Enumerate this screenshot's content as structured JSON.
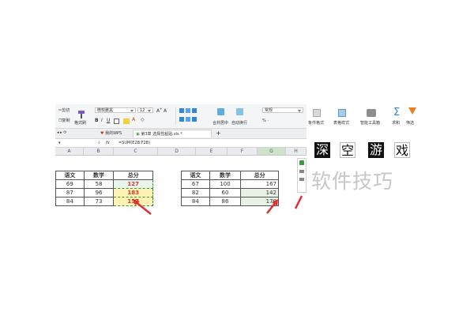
{
  "toolbar": {
    "cut": "剪切",
    "copy": "复制",
    "format_painter": "格式刷",
    "font_name": "微软雅黑",
    "font_size": "12",
    "merge_center": "合并居中",
    "wrap_text": "自动换行",
    "number_format": "常规",
    "conditional_format": "条件格式",
    "table_style": "表格样式",
    "smart_toolbox": "智能工具箱",
    "sum": "求和",
    "filter": "筛选"
  },
  "tabs": {
    "home": "我的WPS",
    "doc": "第3章 选择性粘贴.xls *",
    "add": "+"
  },
  "formula_bar": {
    "fx": "fx",
    "formula": "=SUM(E2B:F2B)"
  },
  "columns": [
    "A",
    "B",
    "C",
    "D",
    "E",
    "F",
    "G",
    "H"
  ],
  "table_left": {
    "headers": [
      "语文",
      "数学",
      "总分"
    ],
    "rows": [
      [
        "69",
        "58",
        "127"
      ],
      [
        "87",
        "96",
        "183"
      ],
      [
        "84",
        "73",
        "157"
      ]
    ]
  },
  "table_right": {
    "headers": [
      "语文",
      "数学",
      "总分"
    ],
    "rows": [
      [
        "67",
        "100",
        "167"
      ],
      [
        "82",
        "60",
        "142"
      ],
      [
        "84",
        "86",
        "170"
      ]
    ]
  },
  "tiles": [
    "深",
    "空",
    "游",
    "戏"
  ],
  "watermark": "软件技巧",
  "colors": {
    "accent_green": "#3a9b3a",
    "highlight_yellow": "#fff2b3",
    "arrow_red": "#e03030"
  }
}
